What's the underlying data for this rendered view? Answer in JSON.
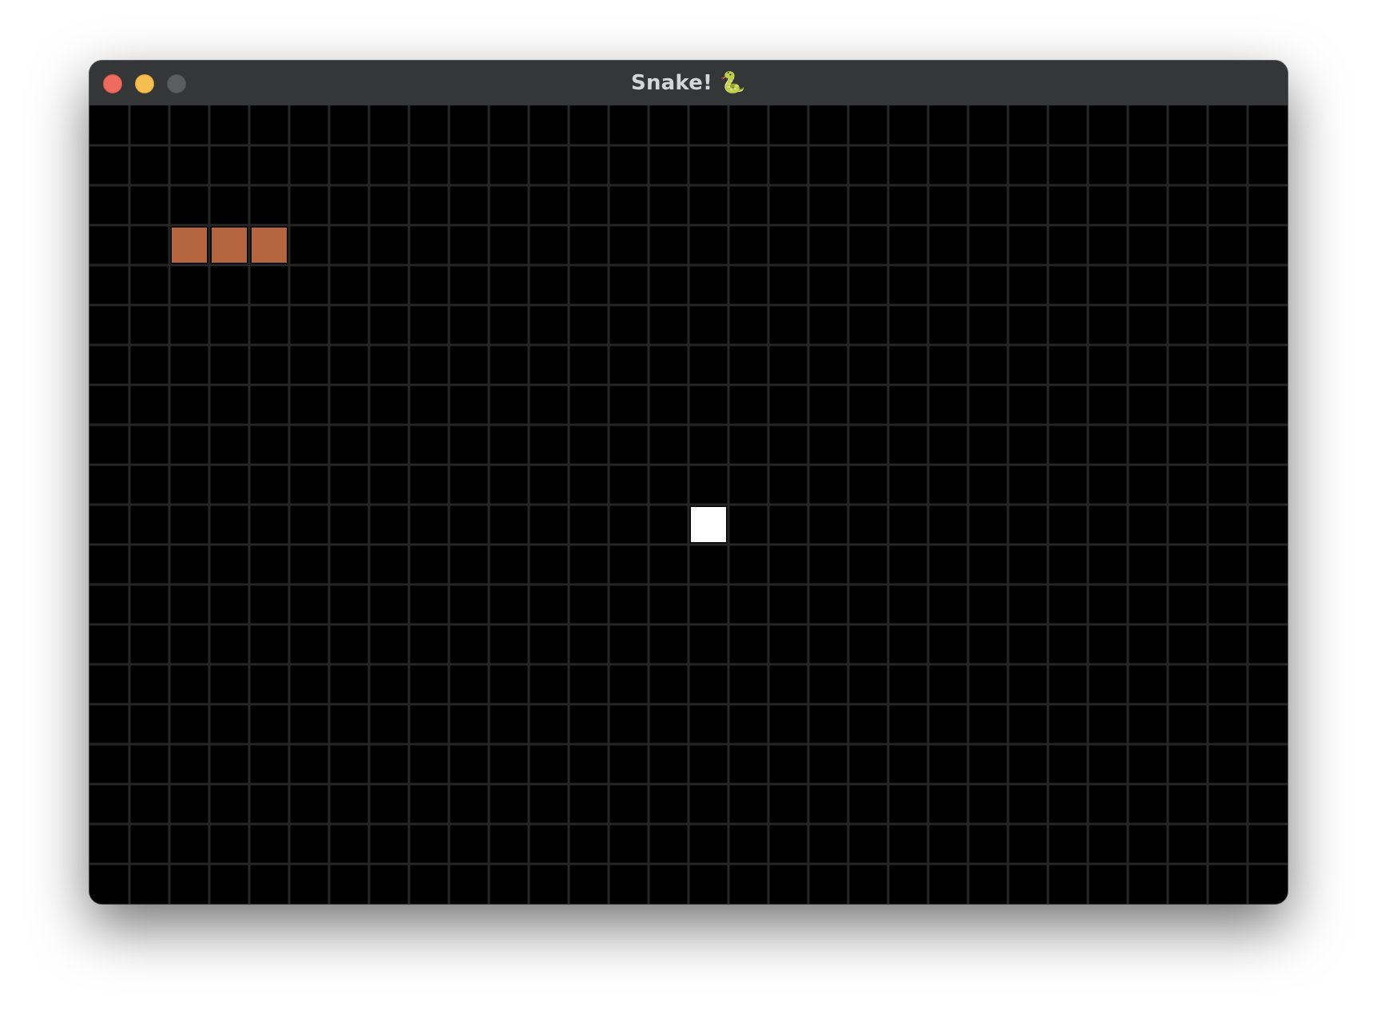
{
  "window": {
    "title": "Snake! 🐍",
    "traffic_lights": {
      "close_color": "#ed6a5e",
      "minimize_color": "#f5bf4f",
      "zoom_color": "#5c5d5f"
    }
  },
  "game": {
    "grid": {
      "columns": 30,
      "rows": 20
    },
    "colors": {
      "background": "#000000",
      "grid_line": "#262626",
      "snake": "#b5653d",
      "food": "#ffffff"
    },
    "snake": [
      {
        "col": 2,
        "row": 3
      },
      {
        "col": 3,
        "row": 3
      },
      {
        "col": 4,
        "row": 3
      }
    ],
    "food": {
      "col": 15,
      "row": 10
    }
  }
}
